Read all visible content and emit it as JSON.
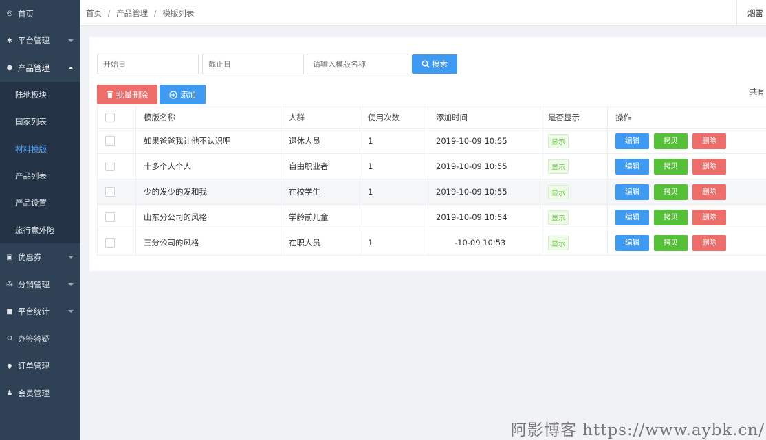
{
  "sidebar": {
    "items": [
      {
        "label": "首页",
        "icon": "dashboard-icon",
        "glyph": "◎",
        "caret": ""
      },
      {
        "label": "平台管理",
        "icon": "gear-icon",
        "glyph": "✱",
        "caret": "down"
      },
      {
        "label": "产品管理",
        "icon": "product-icon",
        "glyph": "●",
        "caret": "up"
      }
    ],
    "sub_items": [
      "陆地板块",
      "国家列表",
      "材料模版",
      "产品列表",
      "产品设置",
      "旅行意外险"
    ],
    "active_sub": "材料模版",
    "items_after": [
      {
        "label": "优惠券",
        "icon": "coupon-icon",
        "glyph": "▣",
        "caret": "down"
      },
      {
        "label": "分销管理",
        "icon": "hierarchy-icon",
        "glyph": "⁂",
        "caret": "down"
      },
      {
        "label": "平台统计",
        "icon": "chart-icon",
        "glyph": "■",
        "caret": "down"
      },
      {
        "label": "办签答疑",
        "icon": "headset-icon",
        "glyph": "Ω",
        "caret": ""
      },
      {
        "label": "订单管理",
        "icon": "layers-icon",
        "glyph": "◆",
        "caret": ""
      },
      {
        "label": "会员管理",
        "icon": "user-icon",
        "glyph": "♟",
        "caret": ""
      }
    ]
  },
  "breadcrumb": [
    "首页",
    "产品管理",
    "模版列表"
  ],
  "top_right_text": "烟雷",
  "filters": {
    "start_placeholder": "开始日",
    "end_placeholder": "截止日",
    "name_placeholder": "请输入模版名称",
    "search_label": "搜索"
  },
  "actions": {
    "batch_delete_label": "批量删除",
    "add_label": "添加"
  },
  "total_text": "共有",
  "table": {
    "headers": [
      "模版名称",
      "人群",
      "使用次数",
      "添加时间",
      "是否显示",
      "操作"
    ],
    "rows": [
      {
        "name": "如果爸爸我让他不认识吧",
        "group": "退休人员",
        "count": "1",
        "time": "2019-10-09 10:55",
        "show": "显示"
      },
      {
        "name": "十多个人个人",
        "group": "自由职业者",
        "count": "1",
        "time": "2019-10-09 10:55",
        "show": "显示"
      },
      {
        "name": "少的发少的发和我",
        "group": "在校学生",
        "count": "1",
        "time": "2019-10-09 10:55",
        "show": "显示"
      },
      {
        "name": "山东分公司的风格",
        "group": "学龄前儿童",
        "count": "",
        "time": "2019-10-09 10:54",
        "show": "显示"
      },
      {
        "name": "三分公司的风格",
        "group": "在职人员",
        "count": "1",
        "time": "-10-09 10:53",
        "show": "显示"
      }
    ],
    "ops": {
      "edit": "编辑",
      "copy": "拷贝",
      "delete": "删除"
    }
  },
  "watermark": "阿影博客 https://www.aybk.cn/",
  "colors": {
    "sidebar": "#2f4155",
    "primary": "#3f9bf1",
    "danger": "#ec6d6a",
    "success": "#57c039",
    "active_text": "#5aa9ff"
  }
}
